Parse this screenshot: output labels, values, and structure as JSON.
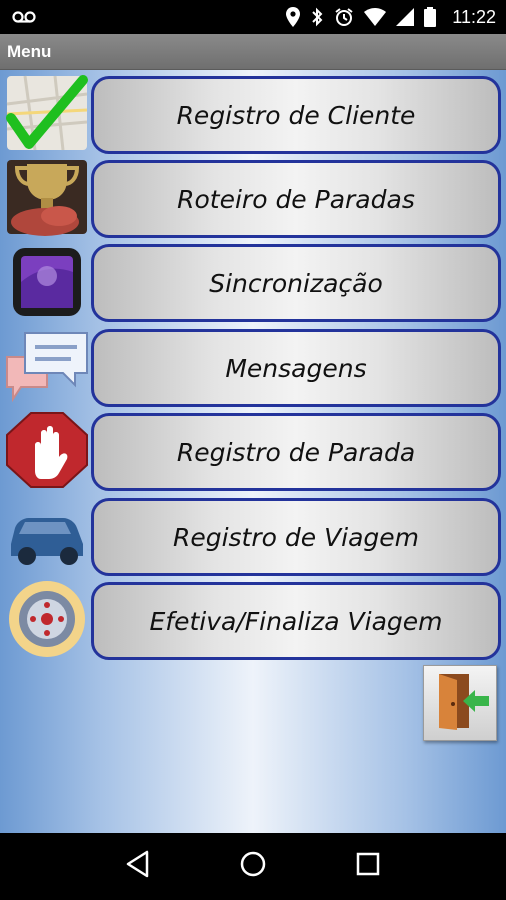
{
  "status_bar": {
    "time": "11:22",
    "icons": [
      "voicemail-icon",
      "location-icon",
      "bluetooth-icon",
      "alarm-icon",
      "wifi-icon",
      "signal-icon",
      "battery-icon"
    ]
  },
  "app_bar": {
    "title": "Menu"
  },
  "menu": {
    "items": [
      {
        "label": "Registro de Cliente",
        "icon": "map-checkmark-icon"
      },
      {
        "label": "Roteiro de Paradas",
        "icon": "trophy-icon"
      },
      {
        "label": "Sincronização",
        "icon": "sync-device-icon"
      },
      {
        "label": "Mensagens",
        "icon": "chat-bubbles-icon"
      },
      {
        "label": "Registro de Parada",
        "icon": "stop-hand-icon"
      },
      {
        "label": "Registro de Viagem",
        "icon": "car-icon"
      },
      {
        "label": "Efetiva/Finaliza Viagem",
        "icon": "wheel-icon"
      }
    ]
  },
  "exit": {
    "icon": "exit-door-icon"
  },
  "nav": {
    "icons": [
      "back-icon",
      "home-icon",
      "recents-icon"
    ]
  },
  "colors": {
    "button_border": "#23339b",
    "app_bar": "#7d7d7d",
    "check_green": "#1fbf1f",
    "stop_red": "#c0282d"
  }
}
